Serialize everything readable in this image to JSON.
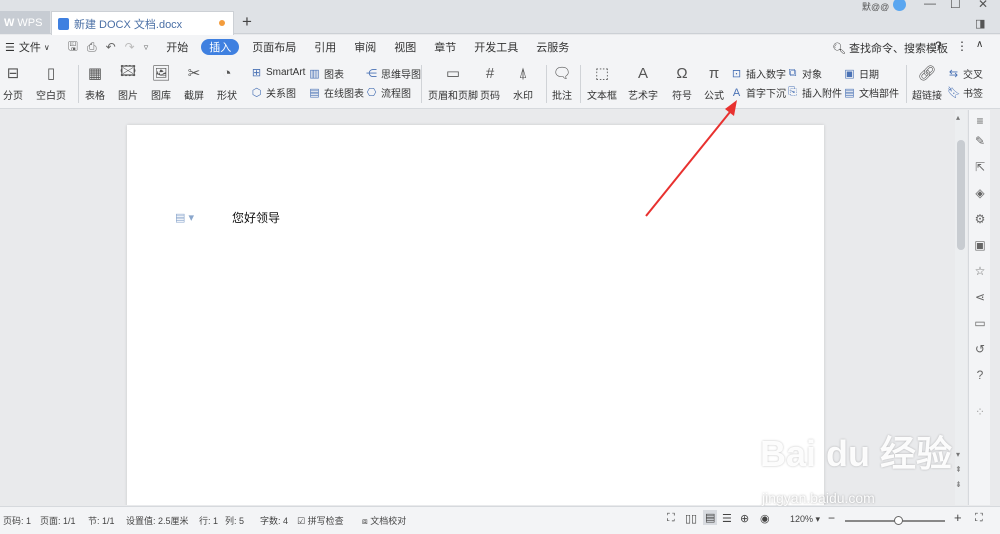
{
  "tabs": {
    "app": "WPS",
    "doc": "新建 DOCX 文档.docx",
    "user": "默@@"
  },
  "menu": {
    "file": "文件",
    "items": [
      "开始",
      "插入",
      "页面布局",
      "引用",
      "审阅",
      "视图",
      "章节",
      "开发工具",
      "云服务"
    ],
    "active": "插入",
    "search": "查找命令、搜索模板"
  },
  "ribbon": {
    "page_break": "分页",
    "blank_page": "空白页",
    "table": "表格",
    "picture": "图片",
    "gallery": "图库",
    "screenshot": "截屏",
    "shape": "形状",
    "smartart": "SmartArt",
    "relation": "关系图",
    "chart": "图表",
    "online_chart": "在线图表",
    "mindmap": "思维导图",
    "flowchart": "流程图",
    "header_footer": "页眉和页脚",
    "page_number": "页码",
    "watermark": "水印",
    "comment": "批注",
    "textbox": "文本框",
    "art_text": "艺术字",
    "symbol": "符号",
    "formula": "公式",
    "insert_number": "插入数字",
    "drop_cap": "首字下沉",
    "object": "对象",
    "attachment": "插入附件",
    "date": "日期",
    "doc_parts": "文档部件",
    "hyperlink": "超链接",
    "crossref": "交叉",
    "bookmark": "书签"
  },
  "document": {
    "text": "您好领导"
  },
  "status": {
    "page_no": "页码: 1",
    "pages": "页面: 1/1",
    "section": "节: 1/1",
    "setting": "设置值: 2.5厘米",
    "row": "行: 1",
    "col": "列: 5",
    "words": "字数: 4",
    "spell": "拼写检查",
    "proof": "文档校对",
    "zoom": "120%"
  },
  "watermark": {
    "brand": "Bai du 经验",
    "url": "jingyan.baidu.com"
  }
}
